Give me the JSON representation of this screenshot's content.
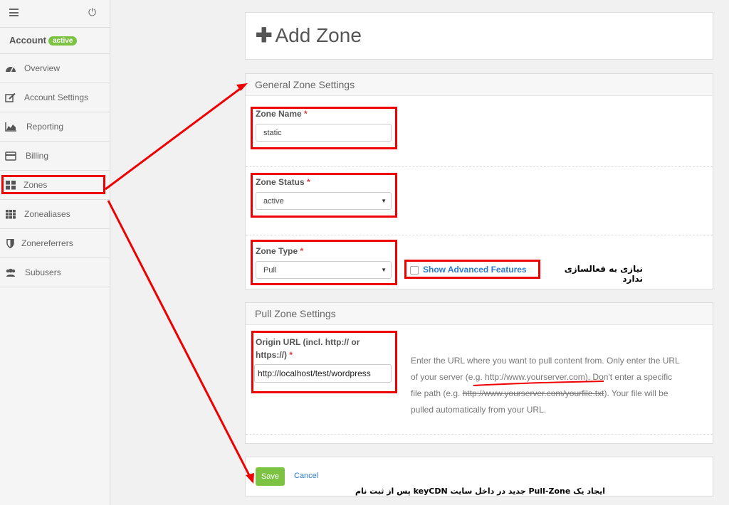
{
  "sidebar": {
    "account_label": "Account",
    "account_badge": "active",
    "items": [
      {
        "label": "Overview",
        "icon": "dashboard-icon"
      },
      {
        "label": "Account Settings",
        "icon": "edit-icon"
      },
      {
        "label": "Reporting",
        "icon": "area-chart-icon"
      },
      {
        "label": "Billing",
        "icon": "credit-card-icon"
      },
      {
        "label": "Zones",
        "icon": "th-large-icon"
      },
      {
        "label": "Zonealiases",
        "icon": "th-icon"
      },
      {
        "label": "Zonereferrers",
        "icon": "shield-icon"
      },
      {
        "label": "Subusers",
        "icon": "users-icon"
      }
    ]
  },
  "page": {
    "title": "Add Zone"
  },
  "general": {
    "heading": "General Zone Settings",
    "zone_name_label": "Zone Name",
    "zone_name_value": "static",
    "zone_status_label": "Zone Status",
    "zone_status_value": "active",
    "zone_type_label": "Zone Type",
    "zone_type_value": "Pull",
    "advanced_label": "Show Advanced Features",
    "required_mark": "*"
  },
  "pull": {
    "heading": "Pull Zone Settings",
    "origin_label_1": "Origin URL (incl. http:// or",
    "origin_label_2": "https://)",
    "origin_value": "http://localhost/test/wordpress",
    "help_1": "Enter the URL where you want to pull content from. Only enter the URL",
    "help_2a": "of your server ",
    "help_2b": "(e.g. http://www.yourserver.com)",
    "help_2c": ". Don't enter a specific",
    "help_3a": "file path (e.g. ",
    "help_3b": "http://www.yourserver.com/yourfile.txt",
    "help_3c": "). Your file will be",
    "help_4": "pulled automatically from your URL."
  },
  "actions": {
    "save_label": "Save",
    "cancel_label": "Cancel"
  },
  "annotations": {
    "advanced_note": "نیازی به فعالسازی ندارد",
    "caption": "ایجاد یک Pull-Zone جدید در داخل سایت keyCDN پس از ثبت نام"
  },
  "colors": {
    "accent_green": "#7cc243",
    "link_blue": "#2b7cd3",
    "annotation_red": "#e00000"
  }
}
